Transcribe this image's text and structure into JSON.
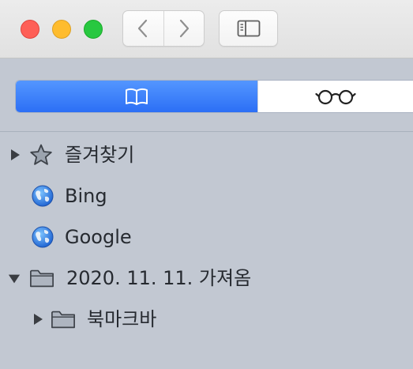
{
  "window": {
    "traffic_lights": [
      "close",
      "minimize",
      "zoom"
    ],
    "colors": {
      "close": "#fe5f57",
      "minimize": "#febc2e",
      "zoom": "#28c840"
    }
  },
  "toolbar": {
    "back_icon": "chevron-left-icon",
    "forward_icon": "chevron-right-icon",
    "sidebar_icon": "sidebar-icon"
  },
  "segmented": {
    "tabs": [
      {
        "icon": "book-icon",
        "selected": true
      },
      {
        "icon": "glasses-icon",
        "selected": false
      }
    ],
    "accent": "#2f72f6"
  },
  "bookmarks": {
    "items": [
      {
        "label": "즐겨찾기",
        "icon": "star-icon",
        "disclosure": "collapsed"
      },
      {
        "label": "Bing",
        "icon": "globe-icon"
      },
      {
        "label": "Google",
        "icon": "globe-icon"
      },
      {
        "label": "2020. 11. 11. 가져옴",
        "icon": "folder-icon",
        "disclosure": "expanded"
      },
      {
        "label": "북마크바",
        "icon": "folder-icon",
        "disclosure": "collapsed"
      }
    ]
  }
}
